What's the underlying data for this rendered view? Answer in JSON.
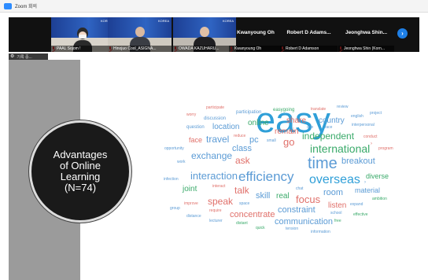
{
  "window": {
    "title": "Zoom 회의"
  },
  "participants": [
    {
      "id": "p1",
      "name": "PAAL Sojom !",
      "banner": "KOREA"
    },
    {
      "id": "p2",
      "name": "Hinojuo Cool_ASIGNA...",
      "banner": "KOREA"
    },
    {
      "id": "p3",
      "name": "OWADA KAZUHARU...",
      "banner": "KOREA"
    },
    {
      "id": "p4",
      "display": "Kwanyoung Oh",
      "name": "Kwanyoung Oh"
    },
    {
      "id": "p5",
      "display": "Robert D Adams...",
      "name": "Robert D Adamson"
    },
    {
      "id": "p6",
      "display": "Jeonghwa Shin...",
      "name": "Jeonghwa Shin (Korn..."
    }
  ],
  "controls": {
    "next_icon": "›"
  },
  "share_bar": {
    "label": "기록 중..."
  },
  "slide": {
    "circle_title": "Advantages\nof Online\nLearning\n(N=74)"
  },
  "wordcloud": [
    {
      "text": "participate",
      "color": "#e0706a"
    },
    {
      "text": "participation",
      "color": "#5b9bd5"
    },
    {
      "text": "easygoing",
      "color": "#3aaa6a"
    },
    {
      "text": "translate",
      "color": "#e0706a"
    },
    {
      "text": "review",
      "color": "#5b9bd5"
    },
    {
      "text": "worry",
      "color": "#e0706a"
    },
    {
      "text": "discussion",
      "color": "#5b9bd5"
    },
    {
      "text": "easy",
      "color": "#2f9fd8"
    },
    {
      "text": "share",
      "color": "#e0706a"
    },
    {
      "text": "country",
      "color": "#5b9bd5"
    },
    {
      "text": "english",
      "color": "#5b9bd5"
    },
    {
      "text": "project",
      "color": "#5b9bd5"
    },
    {
      "text": "question",
      "color": "#5b9bd5"
    },
    {
      "text": "location",
      "color": "#5b9bd5"
    },
    {
      "text": "online",
      "color": "#3aaa6a"
    },
    {
      "text": "one",
      "color": "#5b9bd5"
    },
    {
      "text": "face",
      "color": "#5b9bd5"
    },
    {
      "text": "interpersonal",
      "color": "#5b9bd5"
    },
    {
      "text": "remain",
      "color": "#e0706a"
    },
    {
      "text": "conduct",
      "color": "#e0706a"
    },
    {
      "text": "reduce",
      "color": "#e0706a"
    },
    {
      "text": "face",
      "color": "#e0706a"
    },
    {
      "text": "travel",
      "color": "#5b9bd5"
    },
    {
      "text": "pc",
      "color": "#5b9bd5"
    },
    {
      "text": "small",
      "color": "#5b9bd5"
    },
    {
      "text": "go",
      "color": "#e0706a"
    },
    {
      "text": "independent",
      "color": "#3aaa6a"
    },
    {
      "text": "opportunity",
      "color": "#5b9bd5"
    },
    {
      "text": "class",
      "color": "#5b9bd5"
    },
    {
      "text": "international",
      "color": "#3aaa6a"
    },
    {
      "text": "program",
      "color": "#e0706a"
    },
    {
      "text": "exchange",
      "color": "#5b9bd5"
    },
    {
      "text": "ask",
      "color": "#e0706a"
    },
    {
      "text": "time",
      "color": "#5b9bd5"
    },
    {
      "text": "breakout",
      "color": "#5b9bd5"
    },
    {
      "text": "work",
      "color": "#5b9bd5"
    },
    {
      "text": "efficiency",
      "color": "#5b9bd5"
    },
    {
      "text": "interaction",
      "color": "#5b9bd5"
    },
    {
      "text": "diverse",
      "color": "#3aaa6a"
    },
    {
      "text": "infection",
      "color": "#5b9bd5"
    },
    {
      "text": "overseas",
      "color": "#2f9fd8"
    },
    {
      "text": "joint",
      "color": "#3aaa6a"
    },
    {
      "text": "interact",
      "color": "#e0706a"
    },
    {
      "text": "talk",
      "color": "#e0706a"
    },
    {
      "text": "chat",
      "color": "#5b9bd5"
    },
    {
      "text": "room",
      "color": "#5b9bd5"
    },
    {
      "text": "material",
      "color": "#5b9bd5"
    },
    {
      "text": "skill",
      "color": "#5b9bd5"
    },
    {
      "text": "real",
      "color": "#3aaa6a"
    },
    {
      "text": "focus",
      "color": "#e0706a"
    },
    {
      "text": "ambition",
      "color": "#3aaa6a"
    },
    {
      "text": "speak",
      "color": "#e0706a"
    },
    {
      "text": "group",
      "color": "#5b9bd5"
    },
    {
      "text": "improve",
      "color": "#e0706a"
    },
    {
      "text": "space",
      "color": "#5b9bd5"
    },
    {
      "text": "listen",
      "color": "#e0706a"
    },
    {
      "text": "expand",
      "color": "#5b9bd5"
    },
    {
      "text": "require",
      "color": "#e0706a"
    },
    {
      "text": "constraint",
      "color": "#5b9bd5"
    },
    {
      "text": "school",
      "color": "#5b9bd5"
    },
    {
      "text": "concentrate",
      "color": "#e0706a"
    },
    {
      "text": "effective",
      "color": "#3aaa6a"
    },
    {
      "text": "distance",
      "color": "#5b9bd5"
    },
    {
      "text": "lecturer",
      "color": "#5b9bd5"
    },
    {
      "text": "distant",
      "color": "#3aaa6a"
    },
    {
      "text": "communication",
      "color": "#5b9bd5"
    },
    {
      "text": "free",
      "color": "#3aaa6a"
    },
    {
      "text": "quick",
      "color": "#3aaa6a"
    },
    {
      "text": "tension",
      "color": "#5b9bd5"
    },
    {
      "text": "information",
      "color": "#5b9bd5"
    }
  ]
}
